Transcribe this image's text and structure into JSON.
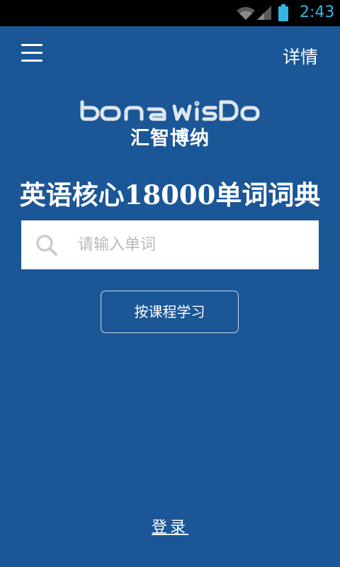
{
  "status_bar": {
    "time": "2:43",
    "icons": [
      "wifi-icon",
      "signal-icon",
      "battery-icon"
    ],
    "clock_color": "#33b5e5"
  },
  "header": {
    "menu_icon": "menu-icon",
    "details_label": "详情"
  },
  "brand": {
    "logo_en": "bona wisdom",
    "logo_zh": "汇智博纳"
  },
  "title": "英语核心18000单词词典",
  "search": {
    "icon": "search-icon",
    "placeholder": "请输入单词",
    "value": ""
  },
  "course_button_label": "按课程学习",
  "login_label": "登录",
  "colors": {
    "background": "#1b5696",
    "status_bar": "#000000",
    "text": "#ffffff",
    "placeholder": "#b9b9b9"
  }
}
